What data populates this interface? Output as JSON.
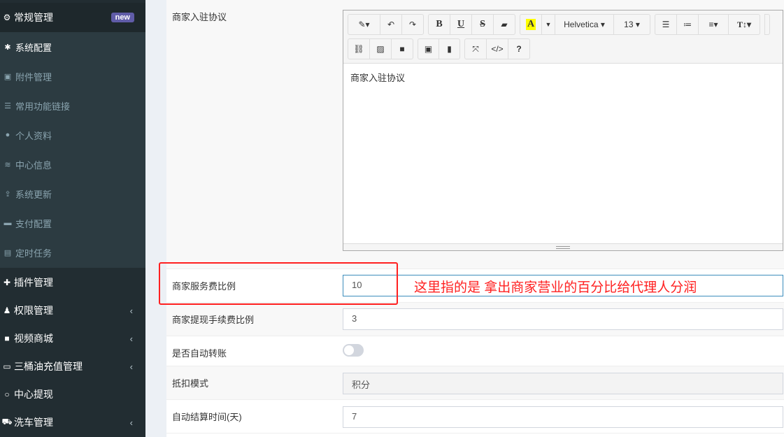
{
  "sidebar": {
    "top": {
      "label": "常规管理",
      "badge": "new"
    },
    "sub": [
      {
        "label": "系统配置",
        "icon": "gear-icon",
        "glyph": "✱"
      },
      {
        "label": "附件管理",
        "icon": "image-file-icon",
        "glyph": "▣"
      },
      {
        "label": "常用功能链接",
        "icon": "list-icon",
        "glyph": "☰"
      },
      {
        "label": "个人资料",
        "icon": "user-icon",
        "glyph": "●"
      },
      {
        "label": "中心信息",
        "icon": "database-icon",
        "glyph": "≋"
      },
      {
        "label": "系统更新",
        "icon": "upload-icon",
        "glyph": "⇪"
      },
      {
        "label": "支付配置",
        "icon": "paypal-icon",
        "glyph": "▬"
      },
      {
        "label": "定时任务",
        "icon": "tasks-icon",
        "glyph": "▤"
      }
    ],
    "items": [
      {
        "label": "插件管理",
        "icon": "plus-icon",
        "glyph": "✚",
        "chevron": ""
      },
      {
        "label": "权限管理",
        "icon": "users-icon",
        "glyph": "♟",
        "chevron": "‹"
      },
      {
        "label": "视频商城",
        "icon": "video-icon",
        "glyph": "■",
        "chevron": "‹"
      },
      {
        "label": "三桶油充值管理",
        "icon": "credit-card-icon",
        "glyph": "▭",
        "chevron": "‹"
      },
      {
        "label": "中心提现",
        "icon": "circle-icon",
        "glyph": "○",
        "chevron": ""
      },
      {
        "label": "洗车管理",
        "icon": "car-icon",
        "glyph": "⛟",
        "chevron": "‹"
      }
    ]
  },
  "form": {
    "agreement": {
      "label": "商家入驻协议",
      "content": "商家入驻协议"
    },
    "editor": {
      "font": "Helvetica ▾",
      "size": "13 ▾"
    },
    "service_fee": {
      "label": "商家服务费比例",
      "value": "10"
    },
    "withdraw_fee": {
      "label": "商家提现手续费比例",
      "value": "3"
    },
    "auto_transfer": {
      "label": "是否自动转账",
      "on": false
    },
    "deduct_mode": {
      "label": "抵扣模式",
      "value": "积分"
    },
    "settle_days": {
      "label": "自动结算时间(天)",
      "value": "7"
    }
  },
  "annotation": {
    "text": "这里指的是 拿出商家营业的百分比给代理人分润",
    "color": "#ff2020"
  }
}
